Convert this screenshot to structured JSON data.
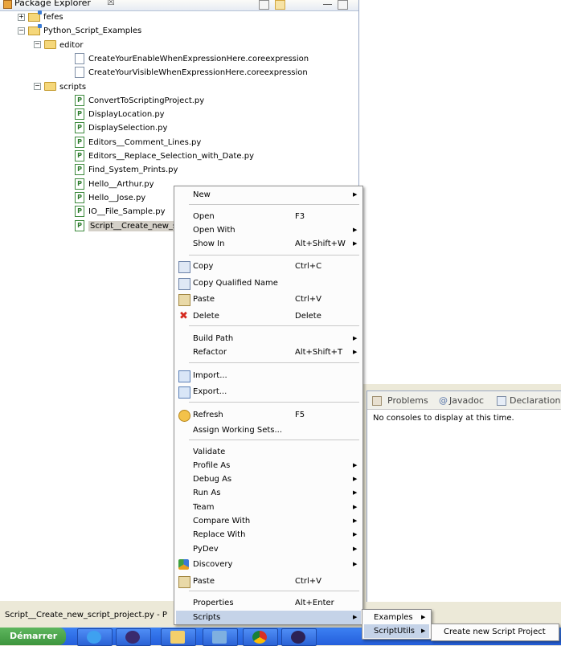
{
  "package_explorer": {
    "title": "Package Explorer",
    "close_glyph": "☒",
    "tree": [
      {
        "label": "fefes",
        "type": "project",
        "expander": "+"
      },
      {
        "label": "Python_Script_Examples",
        "type": "project",
        "expander": "−"
      },
      {
        "label": "editor",
        "type": "folder",
        "expander": "−"
      },
      {
        "label": "CreateYourEnableWhenExpressionHere.coreexpression",
        "type": "file"
      },
      {
        "label": "CreateYourVisibleWhenExpressionHere.coreexpression",
        "type": "file"
      },
      {
        "label": "scripts",
        "type": "folder",
        "expander": "−"
      },
      {
        "label": "ConvertToScriptingProject.py",
        "type": "py"
      },
      {
        "label": "DisplayLocation.py",
        "type": "py"
      },
      {
        "label": "DisplaySelection.py",
        "type": "py"
      },
      {
        "label": "Editors__Comment_Lines.py",
        "type": "py"
      },
      {
        "label": "Editors__Replace_Selection_with_Date.py",
        "type": "py"
      },
      {
        "label": "Find_System_Prints.py",
        "type": "py"
      },
      {
        "label": "Hello__Arthur.py",
        "type": "py"
      },
      {
        "label": "Hello__Jose.py",
        "type": "py"
      },
      {
        "label": "IO__File_Sample.py",
        "type": "py"
      },
      {
        "label": "Script__Create_new_sc",
        "type": "py",
        "selected": true
      }
    ]
  },
  "context_menu": {
    "items": [
      {
        "label": "New",
        "accel": "",
        "submenu": true,
        "icon": ""
      },
      {
        "label": "Open",
        "accel": "F3",
        "submenu": false,
        "icon": ""
      },
      {
        "label": "Open With",
        "accel": "",
        "submenu": true,
        "icon": ""
      },
      {
        "label": "Show In",
        "accel": "Alt+Shift+W",
        "submenu": true,
        "icon": ""
      },
      {
        "label": "Copy",
        "accel": "Ctrl+C",
        "submenu": false,
        "icon": "copy-icon"
      },
      {
        "label": "Copy Qualified Name",
        "accel": "",
        "submenu": false,
        "icon": "copy-qualified-icon"
      },
      {
        "label": "Paste",
        "accel": "Ctrl+V",
        "submenu": false,
        "icon": "paste-icon"
      },
      {
        "label": "Delete",
        "accel": "Delete",
        "submenu": false,
        "icon": "delete-icon"
      },
      {
        "label": "Build Path",
        "accel": "",
        "submenu": true,
        "icon": ""
      },
      {
        "label": "Refactor",
        "accel": "Alt+Shift+T",
        "submenu": true,
        "icon": ""
      },
      {
        "label": "Import...",
        "accel": "",
        "submenu": false,
        "icon": "import-icon"
      },
      {
        "label": "Export...",
        "accel": "",
        "submenu": false,
        "icon": "export-icon"
      },
      {
        "label": "Refresh",
        "accel": "F5",
        "submenu": false,
        "icon": "refresh-icon"
      },
      {
        "label": "Assign Working Sets...",
        "accel": "",
        "submenu": false,
        "icon": ""
      },
      {
        "label": "Validate",
        "accel": "",
        "submenu": false,
        "icon": ""
      },
      {
        "label": "Profile As",
        "accel": "",
        "submenu": true,
        "icon": ""
      },
      {
        "label": "Debug As",
        "accel": "",
        "submenu": true,
        "icon": ""
      },
      {
        "label": "Run As",
        "accel": "",
        "submenu": true,
        "icon": ""
      },
      {
        "label": "Team",
        "accel": "",
        "submenu": true,
        "icon": ""
      },
      {
        "label": "Compare With",
        "accel": "",
        "submenu": true,
        "icon": ""
      },
      {
        "label": "Replace With",
        "accel": "",
        "submenu": true,
        "icon": ""
      },
      {
        "label": "PyDev",
        "accel": "",
        "submenu": true,
        "icon": ""
      },
      {
        "label": "Discovery",
        "accel": "",
        "submenu": true,
        "icon": "discovery-icon"
      },
      {
        "label": "Paste",
        "accel": "Ctrl+V",
        "submenu": false,
        "icon": "paste-icon"
      },
      {
        "label": "Properties",
        "accel": "Alt+Enter",
        "submenu": false,
        "icon": ""
      },
      {
        "label": "Scripts",
        "accel": "",
        "submenu": true,
        "icon": "",
        "highlighted": true
      }
    ]
  },
  "scripts_submenu": {
    "items": [
      {
        "label": "Examples",
        "submenu": true
      },
      {
        "label": "ScriptUtils",
        "submenu": true,
        "highlighted": true
      }
    ]
  },
  "scriptutils_submenu": {
    "items": [
      {
        "label": "Create new Script Project"
      }
    ]
  },
  "console_view": {
    "tabs": [
      {
        "label": "Problems",
        "icon": "problems-icon"
      },
      {
        "label": "Javadoc",
        "icon": "javadoc-icon"
      },
      {
        "label": "Declaration",
        "icon": "declaration-icon"
      }
    ],
    "message": "No consoles to display at this time."
  },
  "status_bar": {
    "text": "Script__Create_new_script_project.py - P"
  },
  "taskbar": {
    "start_label": "Démarrer"
  },
  "colors": {
    "selection": "#d4d0c8",
    "menu_highlight": "#c5d3e8",
    "taskbar": "#245edb",
    "start": "#3d953d"
  }
}
